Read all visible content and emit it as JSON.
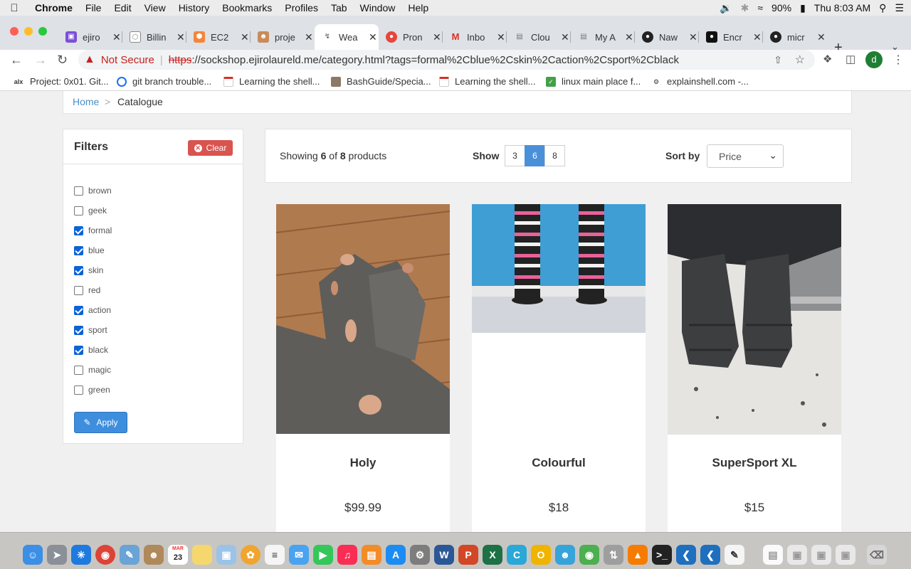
{
  "menubar": {
    "app": "Chrome",
    "items": [
      "File",
      "Edit",
      "View",
      "History",
      "Bookmarks",
      "Profiles",
      "Tab",
      "Window",
      "Help"
    ],
    "battery": "90%",
    "clock": "Thu 8:03 AM"
  },
  "tabs": [
    {
      "label": "ejiro",
      "color": "#7b4fd6"
    },
    {
      "label": "Billin",
      "color": "#888888"
    },
    {
      "label": "EC2",
      "color": "#f58536"
    },
    {
      "label": "proje",
      "color": "#c98b5a"
    },
    {
      "label": "Wea",
      "color": "#555555"
    },
    {
      "label": "Pron",
      "color": "#e8453c"
    },
    {
      "label": "Inbo",
      "color": "#d93025"
    },
    {
      "label": "Clou",
      "color": "#777777"
    },
    {
      "label": "My A",
      "color": "#777777"
    },
    {
      "label": "Naw",
      "color": "#222222"
    },
    {
      "label": "Encr",
      "color": "#111111"
    },
    {
      "label": "micr",
      "color": "#222222"
    }
  ],
  "omnibox": {
    "security": "Not Secure",
    "scheme": "https",
    "url_rest": "://sockshop.ejirolaureld.me/category.html?tags=formal%2Cblue%2Cskin%2Caction%2Csport%2Cblack"
  },
  "profile_initial": "d",
  "bookmarks": [
    "Project: 0x01. Git...",
    "git branch trouble...",
    "Learning the shell...",
    "BashGuide/Specia...",
    "Learning the shell...",
    "linux main place f...",
    "explainshell.com -..."
  ],
  "breadcrumb": {
    "home": "Home",
    "sep": ">",
    "current": "Catalogue"
  },
  "filters": {
    "title": "Filters",
    "clear": "Clear",
    "apply": "Apply",
    "tags": [
      {
        "label": "brown",
        "checked": false
      },
      {
        "label": "geek",
        "checked": false
      },
      {
        "label": "formal",
        "checked": true
      },
      {
        "label": "blue",
        "checked": true
      },
      {
        "label": "skin",
        "checked": true
      },
      {
        "label": "red",
        "checked": false
      },
      {
        "label": "action",
        "checked": true
      },
      {
        "label": "sport",
        "checked": true
      },
      {
        "label": "black",
        "checked": true
      },
      {
        "label": "magic",
        "checked": false
      },
      {
        "label": "green",
        "checked": false
      }
    ]
  },
  "results": {
    "showing_prefix": "Showing",
    "shown": "6",
    "of": "of",
    "total": "8",
    "products": "products",
    "show_label": "Show",
    "page_sizes": [
      "3",
      "6",
      "8"
    ],
    "active_page_size": "6",
    "sort_label": "Sort by",
    "sort_value": "Price"
  },
  "products": [
    {
      "name": "Holy",
      "price": "$99.99"
    },
    {
      "name": "Colourful",
      "price": "$18"
    },
    {
      "name": "SuperSport XL",
      "price": "$15"
    }
  ],
  "dock": {
    "calendar_month": "MAR",
    "calendar_day": "23"
  }
}
